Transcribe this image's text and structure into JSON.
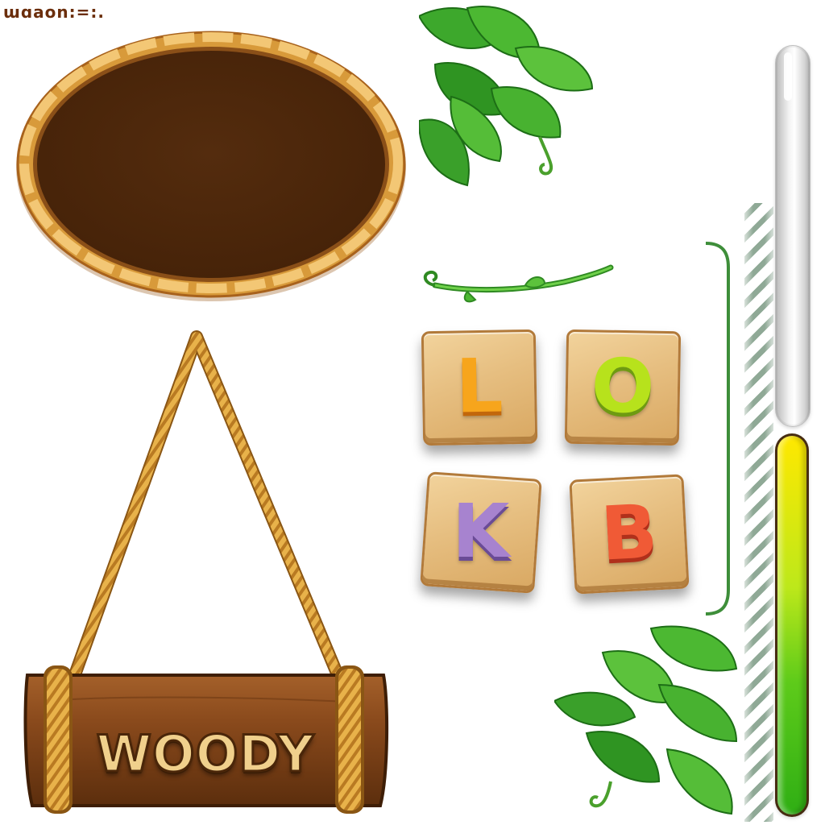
{
  "header": {
    "glyph_strip": "ɯɑaon:=:."
  },
  "sign": {
    "title": "WOODY"
  },
  "tiles": [
    {
      "letter": "L",
      "color": "#f7a51c"
    },
    {
      "letter": "O",
      "color": "#b7e21c"
    },
    {
      "letter": "K",
      "color": "#a783cf"
    },
    {
      "letter": "B",
      "color": "#f05a36"
    }
  ],
  "progress_bars": [
    {
      "name": "empty",
      "fill_fraction": 0.0,
      "color": "#e0e0e0"
    },
    {
      "name": "filled",
      "fill_fraction": 1.0,
      "colors": [
        "#ffe800",
        "#5ecb1a",
        "#2fae14"
      ]
    }
  ],
  "palette": {
    "board_interior": "#4e2a0f",
    "board_frame": "#e6b04a",
    "rope": "#e0a63a",
    "leaf_green": "#3aa12a",
    "bracket_green": "#3e8e3a"
  }
}
